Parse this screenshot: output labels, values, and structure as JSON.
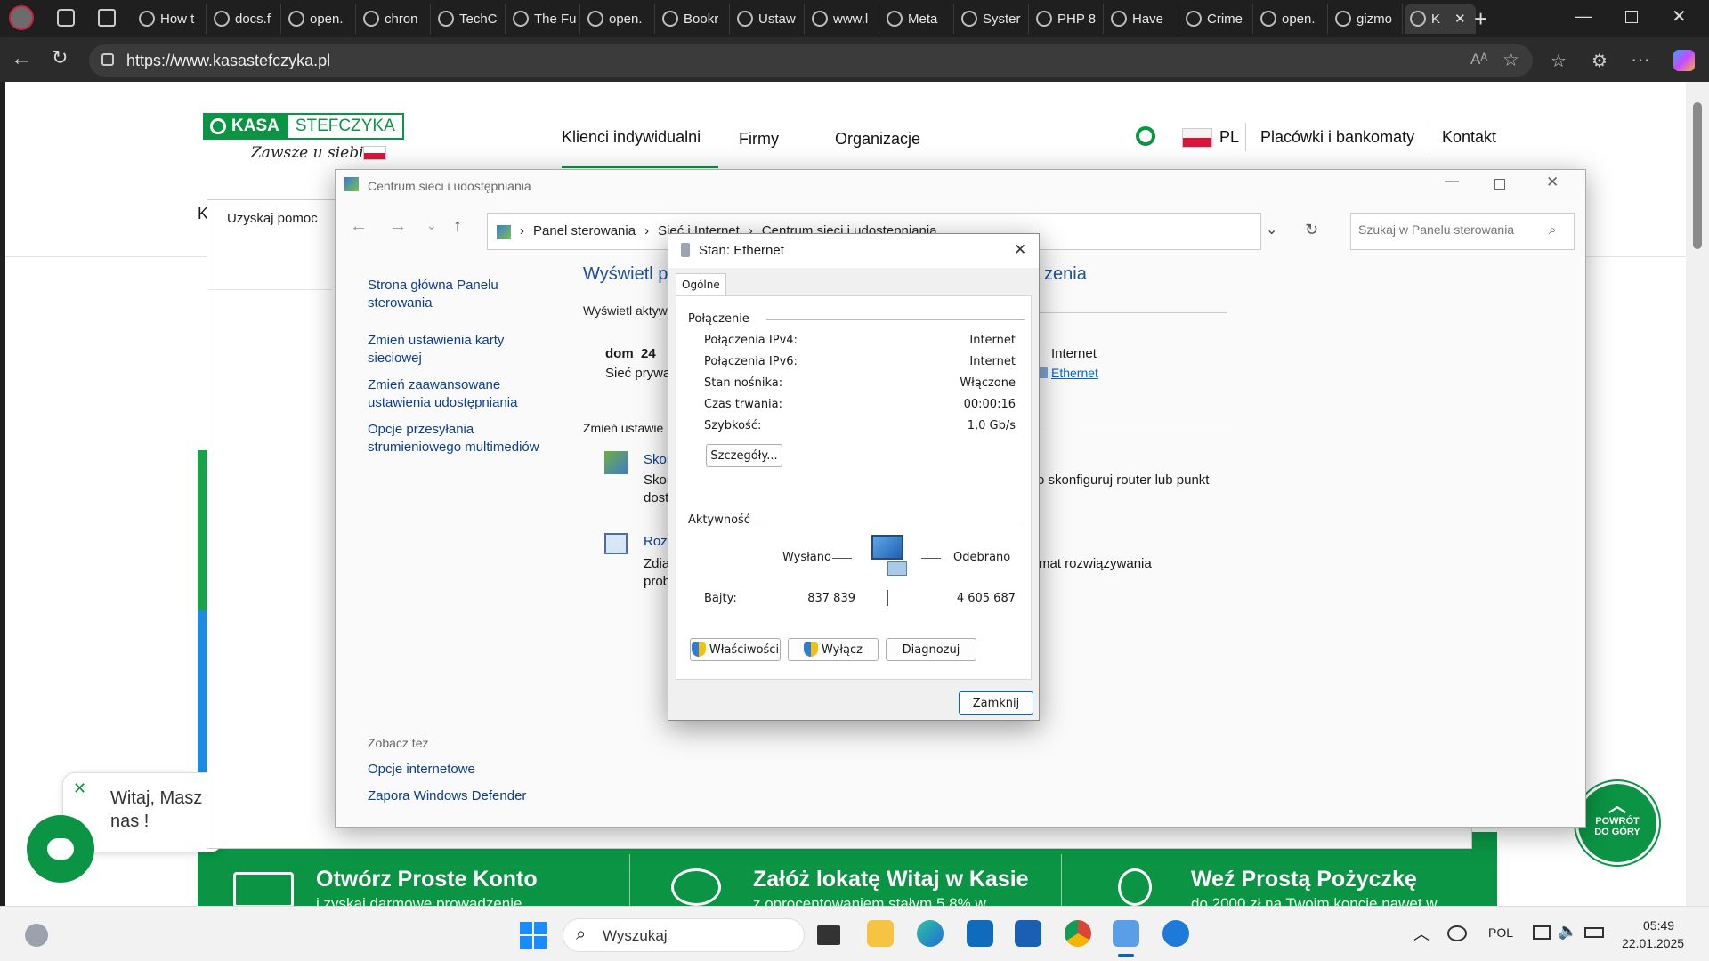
{
  "browser": {
    "tabs": [
      "How t",
      "docs.f",
      "open.",
      "chron",
      "TechC",
      "The Fu",
      "open.",
      "Bookr",
      "Ustaw",
      "www.l",
      "Meta",
      "Syster",
      "PHP 8",
      "Have",
      "Crime",
      "open.",
      "gizmo",
      "K"
    ],
    "url": "https://www.kasastefczyka.pl"
  },
  "site": {
    "logo_text_a": "KASA",
    "logo_text_b": "STEFCZYKA",
    "tagline": "Zawsze u siebie",
    "nav": [
      "Klienci indywidualni",
      "Firmy",
      "Organizacje"
    ],
    "lang": "PL",
    "branches_link": "Placówki i bankomaty",
    "contact_link": "Kontakt",
    "chat_bubble": "Witaj, Masz",
    "chat_bubble_2": "nas !",
    "back_top_1": "POWRÓT",
    "back_top_2": "DO GÓRY",
    "promos": [
      {
        "title": "Otwórz Proste Konto",
        "sub": "i zyskaj darmowe prowadzenie"
      },
      {
        "title": "Załóż lokatę Witaj w Kasie",
        "sub": "z oprocentowaniem stałym 5,8% w"
      },
      {
        "title": "Weź Prostą Pożyczkę",
        "sub": "do 2000 zł na Twoim koncie nawet w"
      }
    ],
    "partial_letter": "K"
  },
  "help_window": {
    "label": "Uzyskaj pomoc"
  },
  "control_panel": {
    "title": "Centrum sieci i udostępniania",
    "breadcrumb": [
      "Panel sterowania",
      "Sieć i Internet",
      "Centrum sieci i udostępniania"
    ],
    "search_placeholder": "Szukaj w Panelu sterowania",
    "sidebar_links": [
      "Strona główna Panelu sterowania",
      "Zmień ustawienia karty sieciowej",
      "Zmień zaawansowane ustawienia udostępniania",
      "Opcje przesyłania strumieniowego multimediów"
    ],
    "see_also_heading": "Zobacz też",
    "see_also_links": [
      "Opcje internetowe",
      "Zapora Windows Defender"
    ],
    "heading_left": "Wyświetl p",
    "heading_right": "zenia",
    "active_label": "Wyświetl aktyw",
    "network_name": "dom_24",
    "network_type": "Sieć prywa",
    "access_type": "Internet",
    "connection_link": "Ethernet",
    "change_label": "Zmień ustawie",
    "item1_title": "Skon",
    "item1_desc_a": "Skon",
    "item1_desc_b": "dost",
    "item1_desc_right": "o skonfiguruj router lub punkt",
    "item2_title": "Rozv",
    "item2_desc_a": "Zdia",
    "item2_desc_b": "prob",
    "item2_desc_right": "mat rozwiązywania"
  },
  "dialog": {
    "title": "Stan: Ethernet",
    "tab": "Ogólne",
    "connection_heading": "Połączenie",
    "rows": [
      {
        "label": "Połączenia IPv4:",
        "value": "Internet"
      },
      {
        "label": "Połączenia IPv6:",
        "value": "Internet"
      },
      {
        "label": "Stan nośnika:",
        "value": "Włączone"
      },
      {
        "label": "Czas trwania:",
        "value": "00:00:16"
      },
      {
        "label": "Szybkość:",
        "value": "1,0 Gb/s"
      }
    ],
    "details_button": "Szczegóły...",
    "activity_heading": "Aktywność",
    "sent_label": "Wysłano",
    "received_label": "Odebrano",
    "bytes_label": "Bajty:",
    "bytes_sent": "837 839",
    "bytes_received": "4 605 687",
    "properties_button": "Właściwości",
    "disable_button": "Wyłącz",
    "diagnose_button": "Diagnozuj",
    "close_button": "Zamknij"
  },
  "taskbar": {
    "search_placeholder": "Wyszukaj",
    "lang": "POL",
    "time": "05:49",
    "date": "22.01.2025"
  },
  "colors": {
    "brand_green": "#0b9444",
    "link_blue": "#0b3d91"
  }
}
